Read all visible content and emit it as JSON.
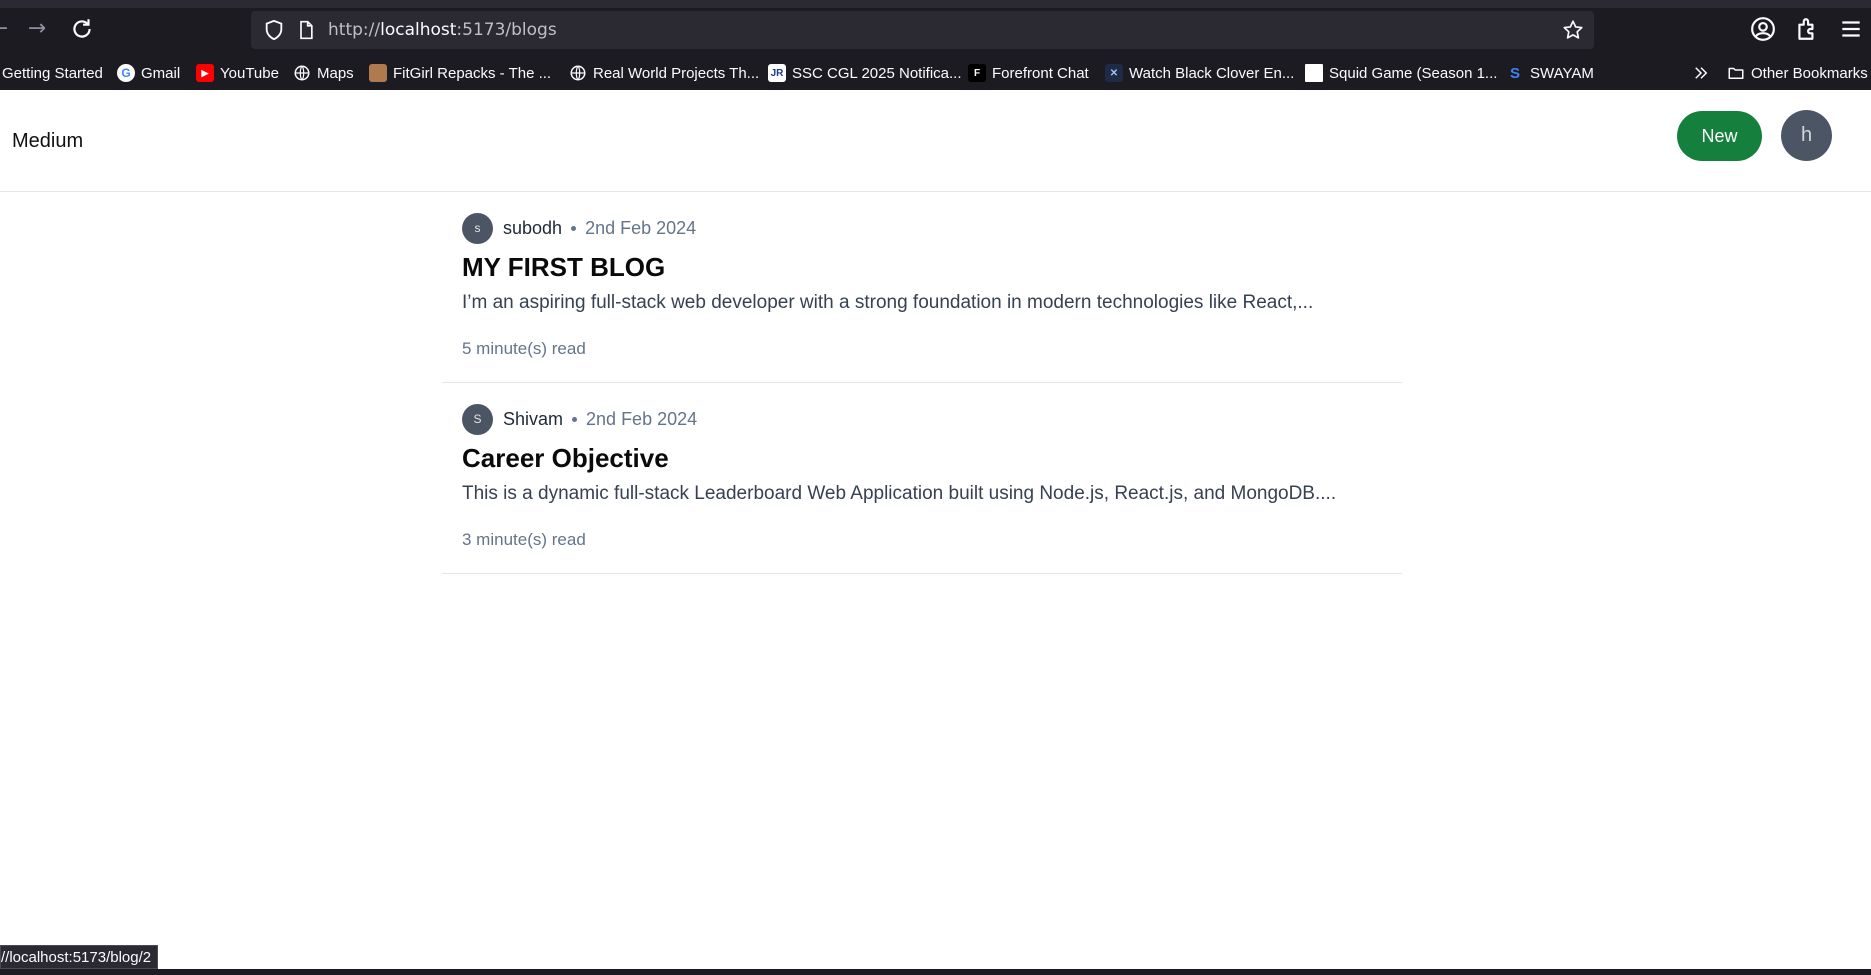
{
  "browser": {
    "url_prefix": "http://",
    "url_host": "localhost",
    "url_rest": ":5173/blogs",
    "status_url": "//localhost:5173/blog/2",
    "bookmarks": [
      {
        "label": "Getting Started",
        "icon": "firefox-icon"
      },
      {
        "label": "Gmail",
        "icon": "google-icon"
      },
      {
        "label": "YouTube",
        "icon": "youtube-icon"
      },
      {
        "label": "Maps",
        "icon": "globe-icon"
      },
      {
        "label": "FitGirl Repacks - The ...",
        "icon": "fitgirl-icon"
      },
      {
        "label": "Real World Projects Th...",
        "icon": "globe-icon"
      },
      {
        "label": "SSC CGL 2025 Notifica...",
        "icon": "jr-icon"
      },
      {
        "label": "Forefront Chat",
        "icon": "forefront-icon"
      },
      {
        "label": "Watch Black Clover En...",
        "icon": "anime-icon"
      },
      {
        "label": "Squid Game (Season 1...",
        "icon": "blank-page-icon"
      },
      {
        "label": "SWAYAM",
        "icon": "swayam-icon"
      }
    ],
    "other_bookmarks": "Other Bookmarks"
  },
  "app": {
    "brand": "Medium",
    "new_button": "New",
    "user_initial": "h"
  },
  "posts": [
    {
      "author_initial": "s",
      "author": "subodh",
      "date": "2nd Feb 2024",
      "title": "MY FIRST BLOG",
      "excerpt": "I’m an aspiring full-stack web developer with a strong foundation in modern technologies like React,...",
      "read_time": "5 minute(s) read"
    },
    {
      "author_initial": "S",
      "author": "Shivam",
      "date": "2nd Feb 2024",
      "title": "Career Objective",
      "excerpt": "This is a dynamic full-stack Leaderboard Web Application built using Node.js, React.js, and MongoDB....",
      "read_time": "3 minute(s) read"
    }
  ],
  "colors": {
    "new_button": "#15803d",
    "avatar": "#4b5563",
    "muted_text": "#64748b",
    "browser_chrome": "#1c1b22"
  }
}
